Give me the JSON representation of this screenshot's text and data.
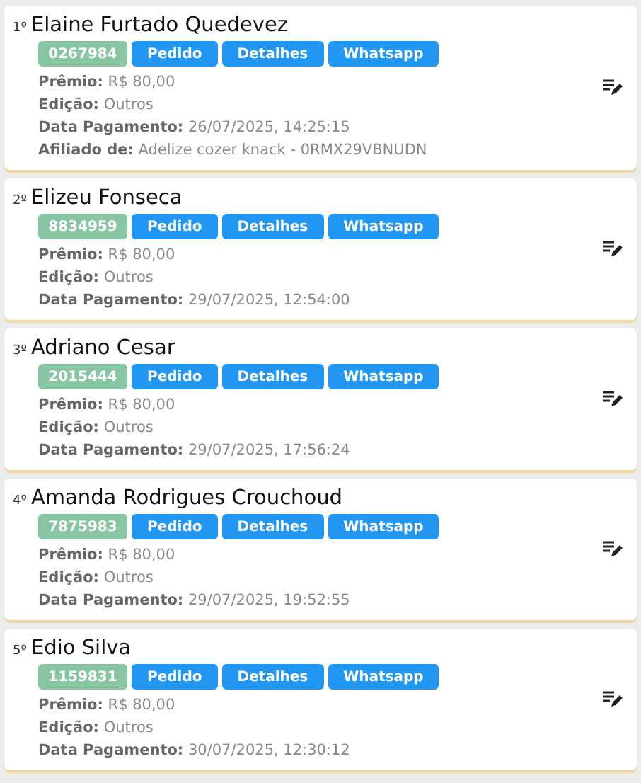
{
  "entries": [
    {
      "rank": "1º",
      "name": "Elaine Furtado Quedevez",
      "code": "0267984",
      "buttons": [
        "Pedido",
        "Detalhes",
        "Whatsapp"
      ],
      "fields": [
        {
          "label": "Prêmio:",
          "value": "R$ 80,00"
        },
        {
          "label": "Edição:",
          "value": "Outros"
        },
        {
          "label": "Data Pagamento:",
          "value": "26/07/2025, 14:25:15"
        },
        {
          "label": "Afiliado de:",
          "value": "Adelize cozer knack - 0RMX29VBNUDN"
        }
      ]
    },
    {
      "rank": "2º",
      "name": "Elizeu Fonseca",
      "code": "8834959",
      "buttons": [
        "Pedido",
        "Detalhes",
        "Whatsapp"
      ],
      "fields": [
        {
          "label": "Prêmio:",
          "value": "R$ 80,00"
        },
        {
          "label": "Edição:",
          "value": "Outros"
        },
        {
          "label": "Data Pagamento:",
          "value": "29/07/2025, 12:54:00"
        }
      ]
    },
    {
      "rank": "3º",
      "name": "Adriano Cesar",
      "code": "2015444",
      "buttons": [
        "Pedido",
        "Detalhes",
        "Whatsapp"
      ],
      "fields": [
        {
          "label": "Prêmio:",
          "value": "R$ 80,00"
        },
        {
          "label": "Edição:",
          "value": "Outros"
        },
        {
          "label": "Data Pagamento:",
          "value": "29/07/2025, 17:56:24"
        }
      ]
    },
    {
      "rank": "4º",
      "name": "Amanda Rodrigues Crouchoud",
      "code": "7875983",
      "buttons": [
        "Pedido",
        "Detalhes",
        "Whatsapp"
      ],
      "fields": [
        {
          "label": "Prêmio:",
          "value": "R$ 80,00"
        },
        {
          "label": "Edição:",
          "value": "Outros"
        },
        {
          "label": "Data Pagamento:",
          "value": "29/07/2025, 19:52:55"
        }
      ]
    },
    {
      "rank": "5º",
      "name": "Edio Silva",
      "code": "1159831",
      "buttons": [
        "Pedido",
        "Detalhes",
        "Whatsapp"
      ],
      "fields": [
        {
          "label": "Prêmio:",
          "value": "R$ 80,00"
        },
        {
          "label": "Edição:",
          "value": "Outros"
        },
        {
          "label": "Data Pagamento:",
          "value": "30/07/2025, 12:30:12"
        }
      ]
    }
  ]
}
